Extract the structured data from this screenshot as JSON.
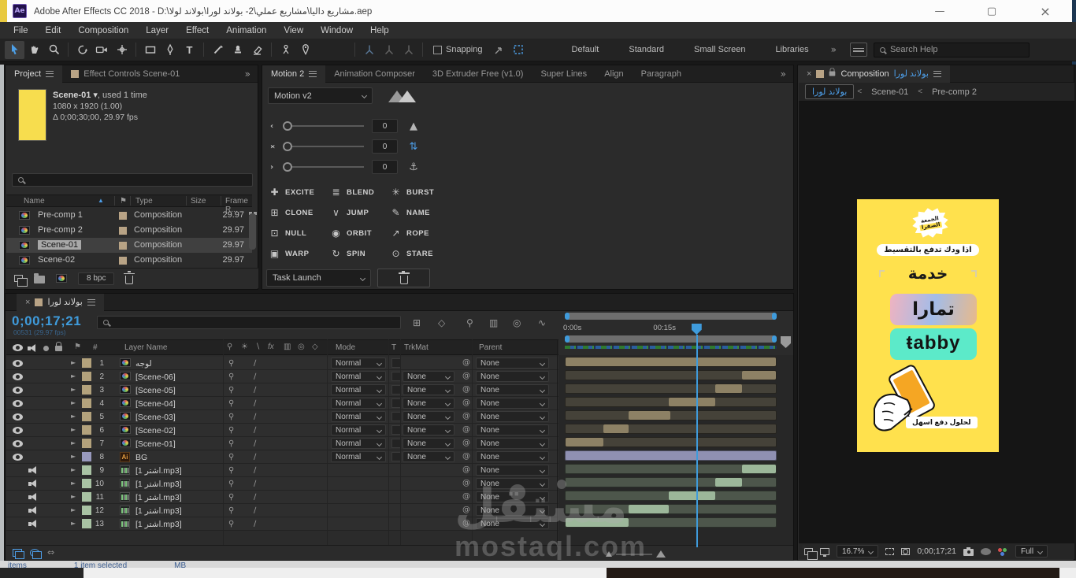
{
  "colors": {
    "accent": "#3f9bdb"
  },
  "window": {
    "title": "Adobe After Effects CC 2018 - D:\\مشاريع داليا\\مشاريع عملي\\2- بولاند لورا\\بولاند لولا.aep",
    "logo": "Ae",
    "minimize": "—",
    "maximize": "▢",
    "close": "×"
  },
  "menu": {
    "items": [
      "File",
      "Edit",
      "Composition",
      "Layer",
      "Effect",
      "Animation",
      "View",
      "Window",
      "Help"
    ]
  },
  "toolbar": {
    "snapping_label": "Snapping",
    "workspaces": [
      "Default",
      "Standard",
      "Small Screen",
      "Libraries"
    ],
    "overflow": "»",
    "search_placeholder": "Search Help"
  },
  "project": {
    "tab_project": "Project",
    "tab_effect_controls": "Effect Controls Scene-01",
    "overflow": "»",
    "preview_name": "Scene-01",
    "preview_usage": ", used 1 time",
    "preview_dims": "1080 x 1920 (1.00)",
    "preview_duration": "Δ 0;00;30;00, 29.97 fps",
    "columns": {
      "name": "Name",
      "type": "Type",
      "size": "Size",
      "frame_rate": "Frame R..."
    },
    "rows": [
      {
        "name": "Pre-comp 1",
        "type": "Composition",
        "frame_rate": "29.97",
        "selected": false,
        "network": true
      },
      {
        "name": "Pre-comp 2",
        "type": "Composition",
        "frame_rate": "29.97",
        "selected": false,
        "network": false
      },
      {
        "name": "Scene-01",
        "type": "Composition",
        "frame_rate": "29.97",
        "selected": true,
        "network": false
      },
      {
        "name": "Scene-02",
        "type": "Composition",
        "frame_rate": "29.97",
        "selected": false,
        "network": false
      }
    ],
    "bpc": "8 bpc"
  },
  "motion": {
    "tabs": [
      {
        "label": "Motion 2",
        "active": true
      },
      {
        "label": "Animation Composer",
        "active": false
      },
      {
        "label": "3D Extruder Free (v1.0)",
        "active": false
      },
      {
        "label": "Super Lines",
        "active": false
      },
      {
        "label": "Align",
        "active": false
      },
      {
        "label": "Paragraph",
        "active": false
      }
    ],
    "overflow": "»",
    "preset": "Motion v2",
    "sliders": [
      {
        "prefix": "‹",
        "value": "0",
        "icon": "rocket"
      },
      {
        "prefix": "›‹",
        "value": "0",
        "icon": "updown"
      },
      {
        "prefix": "›",
        "value": "0",
        "icon": "anchor"
      }
    ],
    "buttons": [
      {
        "label": "EXCITE",
        "glyph": "✚"
      },
      {
        "label": "BLEND",
        "glyph": "≣"
      },
      {
        "label": "BURST",
        "glyph": "✳"
      },
      {
        "label": "CLONE",
        "glyph": "⊞"
      },
      {
        "label": "JUMP",
        "glyph": "∨"
      },
      {
        "label": "NAME",
        "glyph": "✎"
      },
      {
        "label": "NULL",
        "glyph": "⊡"
      },
      {
        "label": "ORBIT",
        "glyph": "◉"
      },
      {
        "label": "ROPE",
        "glyph": "↗"
      },
      {
        "label": "WARP",
        "glyph": "▣"
      },
      {
        "label": "SPIN",
        "glyph": "↻"
      },
      {
        "label": "STARE",
        "glyph": "⊙"
      }
    ],
    "task_preset": "Task Launch"
  },
  "composition": {
    "tab_prefix": "Composition",
    "tab_name": "بولاند لورا",
    "crumb_sep": "<",
    "crumbs": [
      {
        "label": "بولاند لورا",
        "current": true
      },
      {
        "label": "Scene-01",
        "current": false
      },
      {
        "label": "Pre-comp 2",
        "current": false
      }
    ],
    "zoom": "16.7%",
    "timecode": "0;00;17;21",
    "resolution": "Full",
    "poster": {
      "bg_color": "#ffe14d",
      "badge_line1": "الجمعة",
      "badge_line2": "الصفرا",
      "headline": "اذا ودك تدفع بالتقسيط",
      "subhead": "خدمة",
      "brand1": "تمارا",
      "brand1_gradient": [
        "#efb3c0",
        "#a3bce8",
        "#e8b98a"
      ],
      "brand2": "ŧabby",
      "brand2_bg": "#5ceac9",
      "tagline": "لحلول دفع اسهل"
    }
  },
  "timeline": {
    "tab": "بولاند لورا",
    "timecode": "0;00;17;21",
    "frames": "00531 (29.97 fps)",
    "ticks": [
      {
        "label": "0:00s",
        "pct": 0
      },
      {
        "label": "00:15s",
        "pct": 47
      }
    ],
    "playhead_pct": 62,
    "headers": {
      "hash": "#",
      "layer_name": "Layer Name",
      "mode": "Mode",
      "t": "T",
      "trkmat": "TrkMat",
      "parent": "Parent"
    },
    "mode_value": "Normal",
    "none_value": "None",
    "colors": {
      "video_bar": "#454239",
      "video_segment": "#8d8165",
      "bg_bar": "#8f90b2",
      "audio_bar": "#4d564b",
      "audio_segment": "#9cb79a"
    },
    "layers": [
      {
        "num": "1",
        "name": "لوجه",
        "kind": "comp",
        "av": "eye",
        "label_color": "#b3a27c",
        "mode": "Normal",
        "trkmat": "",
        "parent": "None",
        "track": "video",
        "seg": [
          0,
          100
        ]
      },
      {
        "num": "2",
        "name": "[Scene-06]",
        "kind": "comp",
        "av": "eye",
        "label_color": "#b3a27c",
        "mode": "Normal",
        "trkmat": "None",
        "parent": "None",
        "track": "video",
        "seg": [
          84,
          100
        ]
      },
      {
        "num": "3",
        "name": "[Scene-05]",
        "kind": "comp",
        "av": "eye",
        "label_color": "#b3a27c",
        "mode": "Normal",
        "trkmat": "None",
        "parent": "None",
        "track": "video",
        "seg": [
          71,
          84
        ]
      },
      {
        "num": "4",
        "name": "[Scene-04]",
        "kind": "comp",
        "av": "eye",
        "label_color": "#b3a27c",
        "mode": "Normal",
        "trkmat": "None",
        "parent": "None",
        "track": "video",
        "seg": [
          49,
          71
        ]
      },
      {
        "num": "5",
        "name": "[Scene-03]",
        "kind": "comp",
        "av": "eye",
        "label_color": "#b3a27c",
        "mode": "Normal",
        "trkmat": "None",
        "parent": "None",
        "track": "video",
        "seg": [
          30,
          50
        ]
      },
      {
        "num": "6",
        "name": "[Scene-02]",
        "kind": "comp",
        "av": "eye",
        "label_color": "#b3a27c",
        "mode": "Normal",
        "trkmat": "None",
        "parent": "None",
        "track": "video",
        "seg": [
          18,
          30
        ]
      },
      {
        "num": "7",
        "name": "[Scene-01]",
        "kind": "comp",
        "av": "eye",
        "label_color": "#b3a27c",
        "mode": "Normal",
        "trkmat": "None",
        "parent": "None",
        "track": "video",
        "seg": [
          0,
          18
        ]
      },
      {
        "num": "8",
        "name": "BG",
        "kind": "ai",
        "av": "eye",
        "label_color": "#9899bd",
        "mode": "Normal",
        "trkmat": "None",
        "parent": "None",
        "track": "bg",
        "seg": [
          0,
          100
        ]
      },
      {
        "num": "9",
        "name": "[1 اشتر.mp3]",
        "kind": "audio",
        "av": "audio",
        "label_color": "#a9c3a4",
        "mode": "",
        "trkmat": "",
        "parent": "None",
        "track": "audio",
        "seg": [
          84,
          100
        ]
      },
      {
        "num": "10",
        "name": "[1 اشتر.mp3]",
        "kind": "audio",
        "av": "audio",
        "label_color": "#a9c3a4",
        "mode": "",
        "trkmat": "",
        "parent": "None",
        "track": "audio",
        "seg": [
          71,
          84
        ]
      },
      {
        "num": "11",
        "name": "[1 اشتر.mp3]",
        "kind": "audio",
        "av": "audio",
        "label_color": "#a9c3a4",
        "mode": "",
        "trkmat": "",
        "parent": "None",
        "track": "audio",
        "seg": [
          49,
          71
        ]
      },
      {
        "num": "12",
        "name": "[1 اشتر.mp3]",
        "kind": "audio",
        "av": "audio",
        "label_color": "#a9c3a4",
        "mode": "",
        "trkmat": "",
        "parent": "None",
        "track": "audio",
        "seg": [
          30,
          49
        ]
      },
      {
        "num": "13",
        "name": "[1 اشتر.mp3]",
        "kind": "audio",
        "av": "audio",
        "label_color": "#a9c3a4",
        "mode": "",
        "trkmat": "",
        "parent": "None",
        "track": "audio",
        "seg": [
          0,
          30
        ]
      }
    ],
    "watermark_ar": "مستقل",
    "watermark_en": "mostaql.com"
  },
  "behind_window": {
    "status_parts": [
      "items",
      "1 item selected",
      "MB"
    ]
  }
}
